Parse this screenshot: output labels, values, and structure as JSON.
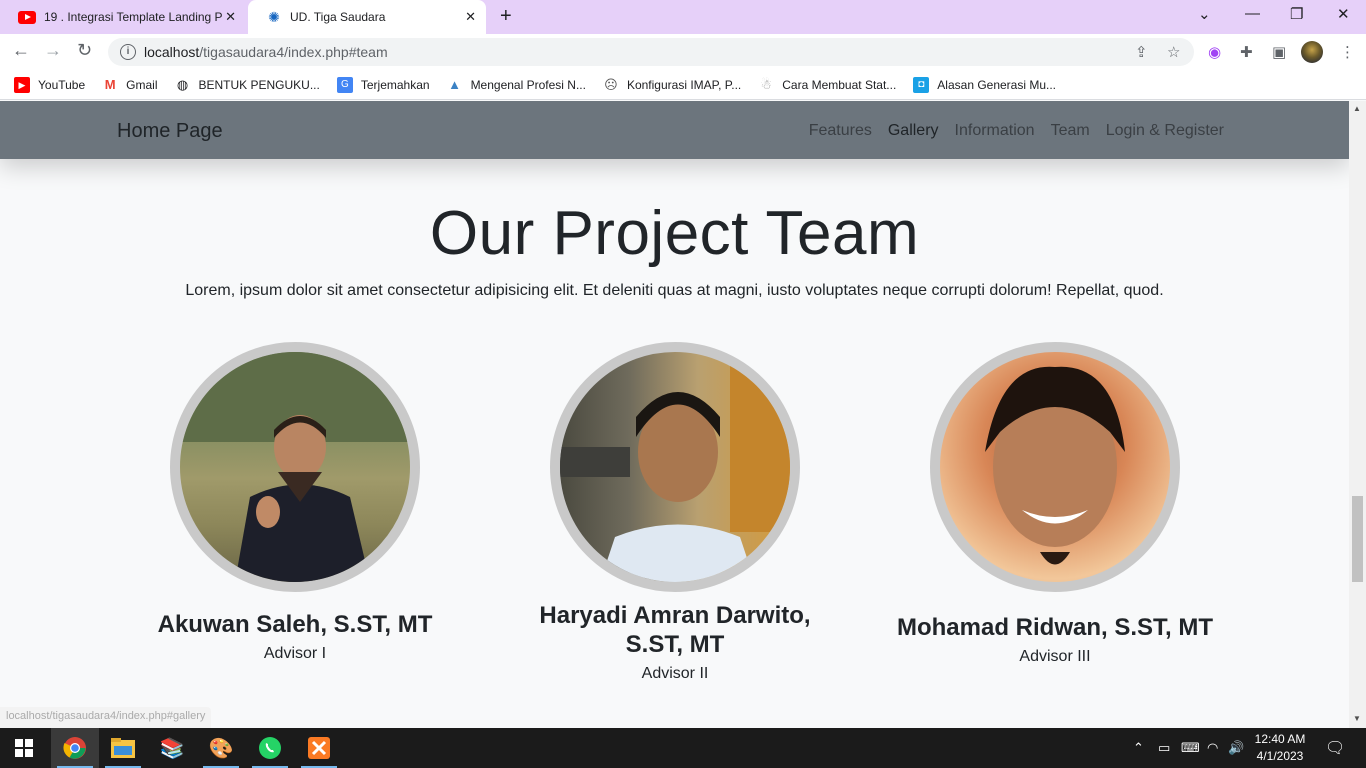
{
  "browser": {
    "tabs": [
      {
        "title": "19 . Integrasi Template Landing P",
        "favicon": "youtube-icon"
      },
      {
        "title": "UD. Tiga Saudara",
        "favicon": "site-icon",
        "active": true
      }
    ],
    "url_host": "localhost",
    "url_path": "/tigasaudara4/index.php#team",
    "bookmarks": [
      {
        "label": "YouTube",
        "icon": "youtube-icon",
        "color": "#ff0000"
      },
      {
        "label": "Gmail",
        "icon": "gmail-icon",
        "color": "#ea4335"
      },
      {
        "label": "BENTUK PENGUKU...",
        "icon": "globe-icon",
        "color": "#202124"
      },
      {
        "label": "Terjemahkan",
        "icon": "translate-icon",
        "color": "#4285f4"
      },
      {
        "label": "Mengenal Profesi N...",
        "icon": "arrow-logo-icon",
        "color": "#3b82c4"
      },
      {
        "label": "Konfigurasi IMAP, P...",
        "icon": "face-icon",
        "color": "#555555"
      },
      {
        "label": "Cara Membuat Stat...",
        "icon": "figure-icon",
        "color": "#888888"
      },
      {
        "label": "Alasan Generasi Mu...",
        "icon": "square-logo-icon",
        "color": "#1aa1e6"
      }
    ],
    "status_url": "localhost/tigasaudara4/index.php#gallery"
  },
  "site": {
    "brand": "Home Page",
    "nav": [
      "Features",
      "Gallery",
      "Information",
      "Team",
      "Login & Register"
    ],
    "team": {
      "title": "Our Project Team",
      "description": "Lorem, ipsum dolor sit amet consectetur adipisicing elit. Et deleniti quas at magni, iusto voluptates neque corrupti dolorum! Repellat, quod.",
      "members": [
        {
          "name": "Akuwan Saleh, S.ST, MT",
          "role": "Advisor I"
        },
        {
          "name": "Haryadi Amran Darwito, S.ST, MT",
          "role": "Advisor II"
        },
        {
          "name": "Mohamad Ridwan, S.ST, MT",
          "role": "Advisor III"
        }
      ]
    }
  },
  "taskbar": {
    "time": "12:40 AM",
    "date": "4/1/2023"
  }
}
